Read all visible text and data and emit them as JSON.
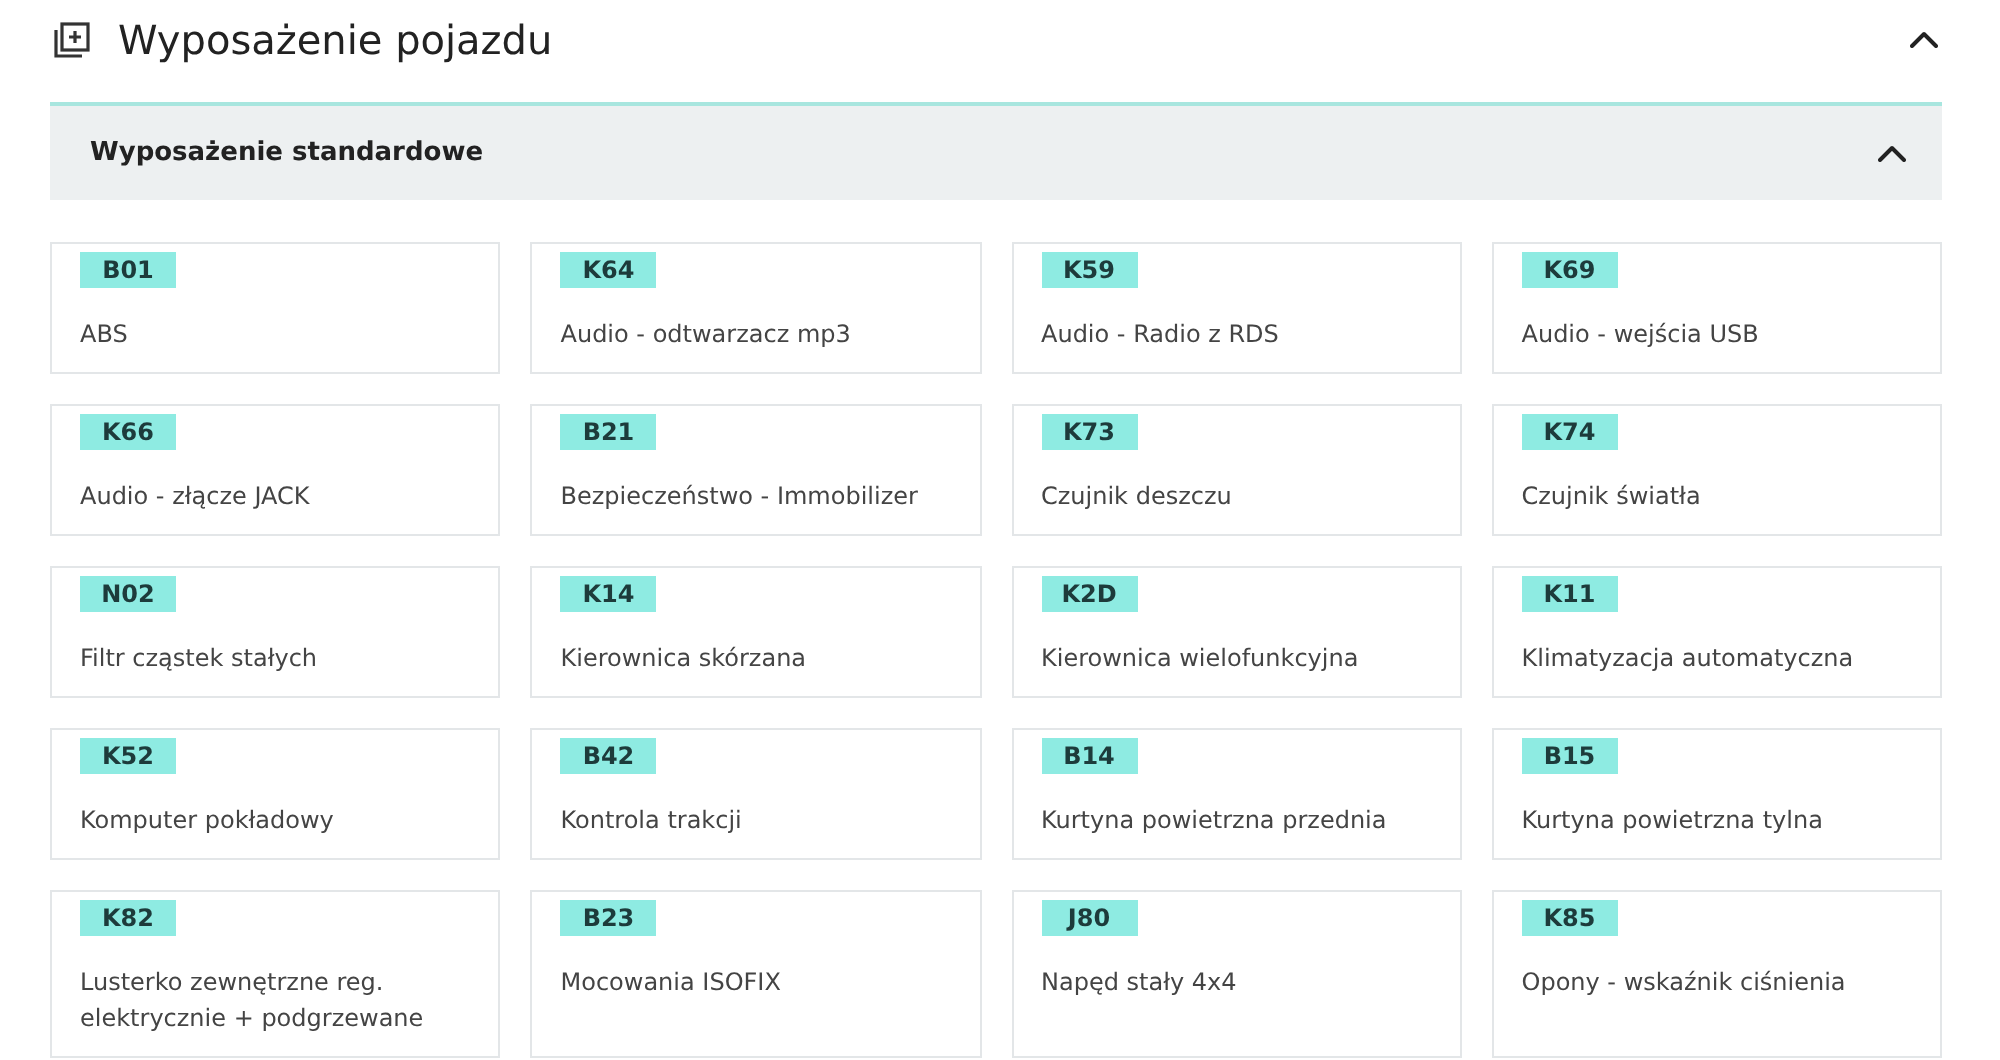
{
  "section": {
    "title": "Wyposażenie pojazdu",
    "expanded": true,
    "subsection": {
      "title": "Wyposażenie standardowe",
      "expanded": true,
      "items": [
        {
          "code": "B01",
          "name": "ABS"
        },
        {
          "code": "K64",
          "name": "Audio - odtwarzacz mp3"
        },
        {
          "code": "K59",
          "name": "Audio - Radio z RDS"
        },
        {
          "code": "K69",
          "name": "Audio - wejścia USB"
        },
        {
          "code": "K66",
          "name": "Audio - złącze JACK"
        },
        {
          "code": "B21",
          "name": "Bezpieczeństwo - Immobilizer"
        },
        {
          "code": "K73",
          "name": "Czujnik deszczu"
        },
        {
          "code": "K74",
          "name": "Czujnik światła"
        },
        {
          "code": "N02",
          "name": "Filtr cząstek stałych"
        },
        {
          "code": "K14",
          "name": "Kierownica skórzana"
        },
        {
          "code": "K2D",
          "name": "Kierownica wielofunkcyjna"
        },
        {
          "code": "K11",
          "name": "Klimatyzacja automatyczna"
        },
        {
          "code": "K52",
          "name": "Komputer pokładowy"
        },
        {
          "code": "B42",
          "name": "Kontrola trakcji"
        },
        {
          "code": "B14",
          "name": "Kurtyna powietrzna przednia"
        },
        {
          "code": "B15",
          "name": "Kurtyna powietrzna tylna"
        },
        {
          "code": "K82",
          "name": "Lusterko zewnętrzne reg. elektrycznie + podgrzewane"
        },
        {
          "code": "B23",
          "name": "Mocowania ISOFIX"
        },
        {
          "code": "J80",
          "name": "Napęd stały 4x4"
        },
        {
          "code": "K85",
          "name": "Opony - wskaźnik ciśnienia"
        }
      ]
    }
  }
}
